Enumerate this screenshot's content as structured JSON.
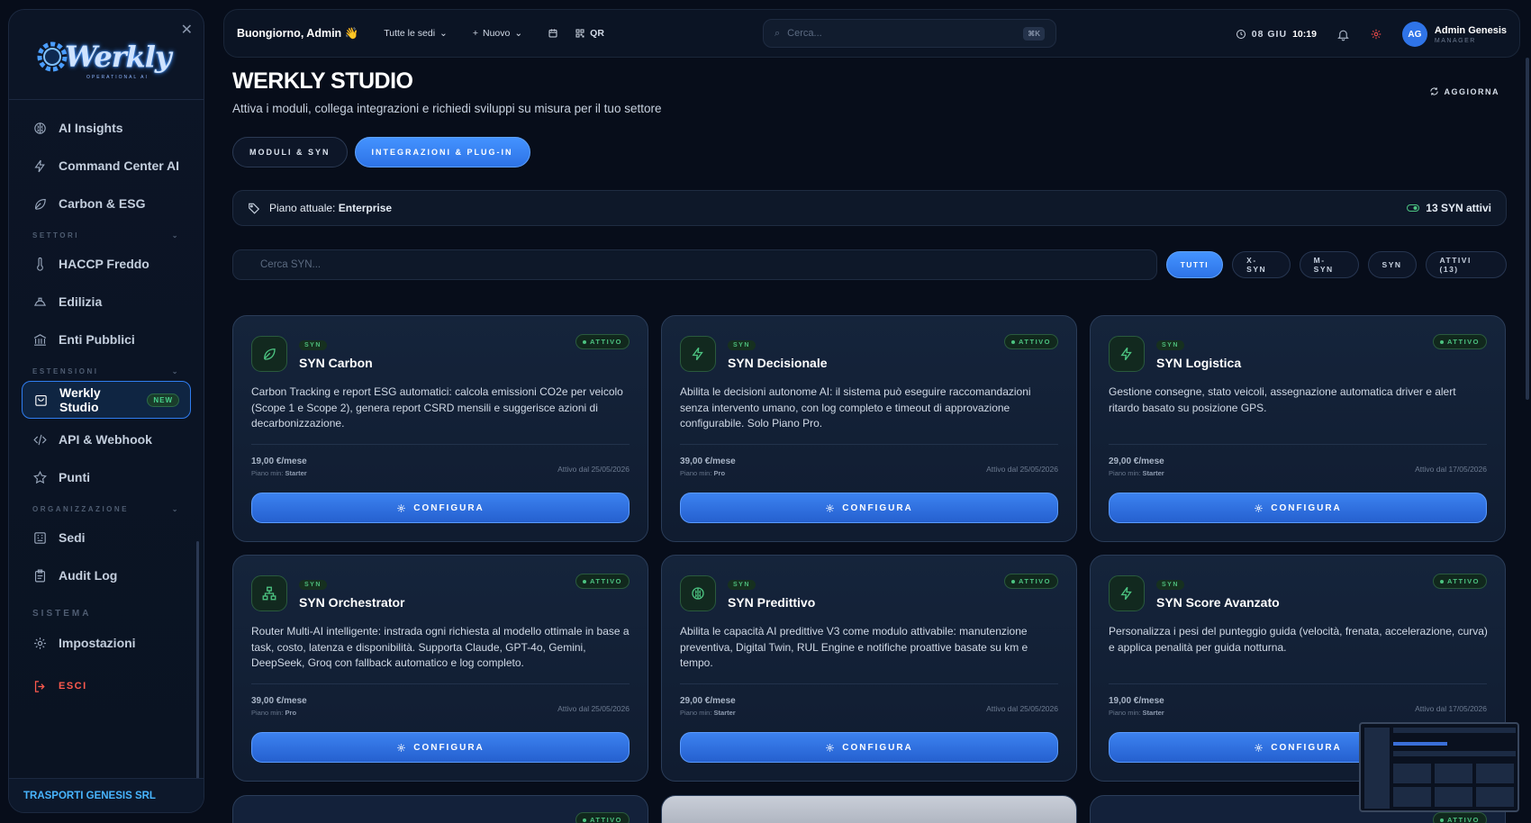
{
  "sidebar": {
    "logo_text": "Werkly",
    "logo_tagline": "OPERATIONAL AI",
    "items_top": [
      {
        "label": "AI Insights",
        "icon": "brain-icon"
      },
      {
        "label": "Command Center AI",
        "icon": "bolt-icon"
      },
      {
        "label": "Carbon & ESG",
        "icon": "leaf-icon"
      }
    ],
    "section_settori": "SETTORI",
    "items_settori": [
      {
        "label": "HACCP Freddo",
        "icon": "thermometer-icon"
      },
      {
        "label": "Edilizia",
        "icon": "helmet-icon"
      },
      {
        "label": "Enti Pubblici",
        "icon": "landmark-icon"
      }
    ],
    "section_estensioni": "ESTENSIONI",
    "items_estensioni": [
      {
        "label": "Werkly Studio",
        "icon": "store-icon",
        "badge": "NEW",
        "active": true
      },
      {
        "label": "API & Webhook",
        "icon": "code-icon"
      },
      {
        "label": "Punti",
        "icon": "star-icon"
      }
    ],
    "section_org": "ORGANIZZAZIONE",
    "items_org": [
      {
        "label": "Sedi",
        "icon": "building-icon"
      },
      {
        "label": "Audit Log",
        "icon": "clipboard-icon"
      }
    ],
    "section_sistema": "SISTEMA",
    "settings_label": "Impostazioni",
    "logout_label": "ESCI",
    "company": "TRASPORTI GENESIS SRL"
  },
  "topbar": {
    "greeting": "Buongiorno, Admin 👋",
    "sites": "Tutte le sedi",
    "new": "Nuovo",
    "qr": "QR",
    "search_placeholder": "Cerca...",
    "search_shortcut": "⌘K",
    "date": "08 GIU",
    "time": "10:19",
    "user_initials": "AG",
    "user_name": "Admin Genesis",
    "user_role": "MANAGER"
  },
  "page": {
    "title": "WERKLY STUDIO",
    "subtitle": "Attiva i moduli, collega integrazioni e richiedi sviluppi su misura per il tuo settore",
    "refresh": "AGGIORNA",
    "tabs": [
      "MODULI & SYN",
      "INTEGRAZIONI & PLUG-IN"
    ],
    "plan_prefix": "Piano attuale: ",
    "plan_name": "Enterprise",
    "active_syn": "13 SYN attivi",
    "syn_search_placeholder": "Cerca SYN...",
    "filters": [
      "TUTTI",
      "X-SYN",
      "M-SYN",
      "SYN",
      "ATTIVI (13)"
    ]
  },
  "cards": [
    {
      "tag": "SYN",
      "title": "SYN Carbon",
      "status": "ATTIVO",
      "icon": "leaf-icon",
      "desc": "Carbon Tracking e report ESG automatici: calcola emissioni CO2e per veicolo (Scope 1 e Scope 2), genera report CSRD mensili e suggerisce azioni di decarbonizzazione.",
      "price": "19,00 €/mese",
      "plan_label": "Piano min: ",
      "plan_min": "Starter",
      "since": "Attivo dal 25/05/2026",
      "action": "CONFIGURA"
    },
    {
      "tag": "SYN",
      "title": "SYN Decisionale",
      "status": "ATTIVO",
      "icon": "bolt-icon",
      "desc": "Abilita le decisioni autonome AI: il sistema può eseguire raccomandazioni senza intervento umano, con log completo e timeout di approvazione configurabile. Solo Piano Pro.",
      "price": "39,00 €/mese",
      "plan_label": "Piano min: ",
      "plan_min": "Pro",
      "since": "Attivo dal 25/05/2026",
      "action": "CONFIGURA"
    },
    {
      "tag": "SYN",
      "title": "SYN Logistica",
      "status": "ATTIVO",
      "icon": "bolt-icon",
      "desc": "Gestione consegne, stato veicoli, assegnazione automatica driver e alert ritardo basato su posizione GPS.",
      "price": "29,00 €/mese",
      "plan_label": "Piano min: ",
      "plan_min": "Starter",
      "since": "Attivo dal 17/05/2026",
      "action": "CONFIGURA"
    },
    {
      "tag": "SYN",
      "title": "SYN Orchestrator",
      "status": "ATTIVO",
      "icon": "network-icon",
      "desc": "Router Multi-AI intelligente: instrada ogni richiesta al modello ottimale in base a task, costo, latenza e disponibilità. Supporta Claude, GPT-4o, Gemini, DeepSeek, Groq con fallback automatico e log completo.",
      "price": "39,00 €/mese",
      "plan_label": "Piano min: ",
      "plan_min": "Pro",
      "since": "Attivo dal 25/05/2026",
      "action": "CONFIGURA"
    },
    {
      "tag": "SYN",
      "title": "SYN Predittivo",
      "status": "ATTIVO",
      "icon": "brain-icon",
      "desc": "Abilita le capacità AI predittive V3 come modulo attivabile: manutenzione preventiva, Digital Twin, RUL Engine e notifiche proattive basate su km e tempo.",
      "price": "29,00 €/mese",
      "plan_label": "Piano min: ",
      "plan_min": "Starter",
      "since": "Attivo dal 25/05/2026",
      "action": "CONFIGURA"
    },
    {
      "tag": "SYN",
      "title": "SYN Score Avanzato",
      "status": "ATTIVO",
      "icon": "bolt-icon",
      "desc": "Personalizza i pesi del punteggio guida (velocità, frenata, accelerazione, curva) e applica penalità per guida notturna.",
      "price": "19,00 €/mese",
      "plan_label": "Piano min: ",
      "plan_min": "Starter",
      "since": "Attivo dal 17/05/2026",
      "action": "CONFIGURA"
    }
  ],
  "peek_cards": [
    {
      "status": "ATTIVO"
    },
    {
      "status": ""
    },
    {
      "status": "ATTIVO"
    }
  ],
  "colors": {
    "accent": "#2f7df0",
    "active_green": "#4cc381",
    "danger": "#ff5a4e",
    "company": "#48b5ff"
  }
}
